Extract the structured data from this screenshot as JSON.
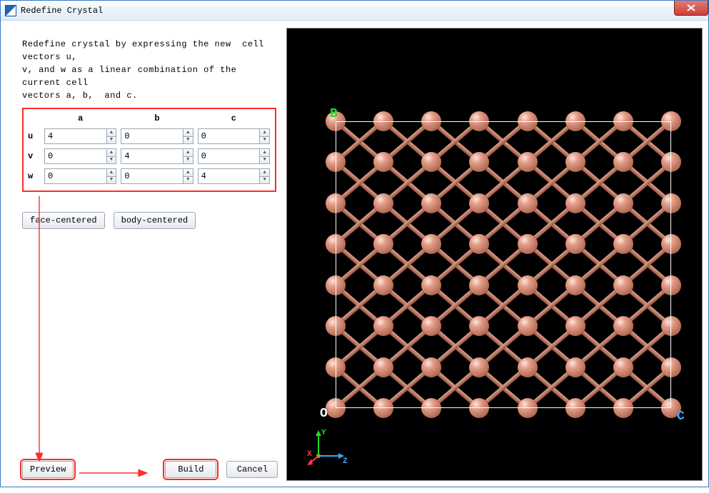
{
  "window": {
    "title": "Redefine Crystal"
  },
  "description": "Redefine crystal by expressing the new  cell vectors u,\nv, and w as a linear combination of the current cell\nvectors a, b,  and c.",
  "matrix": {
    "cols": [
      "a",
      "b",
      "c"
    ],
    "rows": [
      "u",
      "v",
      "w"
    ],
    "values": {
      "u": {
        "a": "4",
        "b": "0",
        "c": "0"
      },
      "v": {
        "a": "0",
        "b": "4",
        "c": "0"
      },
      "w": {
        "a": "0",
        "b": "0",
        "c": "4"
      }
    }
  },
  "buttons": {
    "face_centered": "face-centered",
    "body_centered": "body-centered",
    "preview": "Preview",
    "build": "Build",
    "cancel": "Cancel"
  },
  "viewport": {
    "labelB": "B",
    "labelO": "O",
    "labelC": "C",
    "axis": {
      "x": "X",
      "y": "Y",
      "z": "Z"
    }
  },
  "colors": {
    "accent_red": "#ff2a2a",
    "atom": "#c47a63"
  }
}
